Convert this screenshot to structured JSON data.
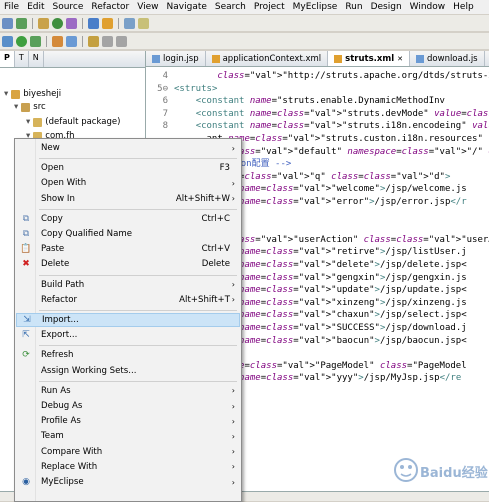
{
  "menubar": [
    "File",
    "Edit",
    "Source",
    "Refactor",
    "View",
    "Navigate",
    "Search",
    "Project",
    "MyEclipse",
    "Run",
    "Design",
    "Window",
    "Help"
  ],
  "left_tabs": [
    "P",
    "T",
    "N"
  ],
  "tree": [
    {
      "label": "biyesheji"
    },
    {
      "label": "src"
    },
    {
      "label": "(default package)"
    },
    {
      "label": "com.fh"
    }
  ],
  "editor_tabs": [
    {
      "label": "login.jsp",
      "active": false
    },
    {
      "label": "applicationContext.xml",
      "active": false
    },
    {
      "label": "struts.xml",
      "active": true
    },
    {
      "label": "download.js",
      "active": false
    }
  ],
  "code_lines": [
    {
      "ln": "4",
      "text": "        \"http://struts.apache.org/dtds/struts-2.0.dtd\""
    },
    {
      "ln": "5⊖",
      "text": "<struts>"
    },
    {
      "ln": "6",
      "text": "    <constant name=\"struts.enable.DynamicMethodInv"
    },
    {
      "ln": "7",
      "text": "    <constant name=\"struts.devMode\" value=\"true\" /"
    },
    {
      "ln": "8",
      "text": "    <constant name=\"struts.i18n.encodeing\" value=\""
    },
    {
      "ln": "",
      "text": "      ant name=\"struts.custon.i18n.resources\""
    },
    {
      "ln": "",
      "text": "  ge name=\"default\" namespace=\"/\" extends="
    },
    {
      "ln": "",
      "text": "  -- 订单Action配置 -->"
    },
    {
      "ln": "",
      "text": "  ction name=\"q\" class=\"d\">"
    },
    {
      "ln": "",
      "text": "    <result name=\"welcome\">/jsp/welcome.js"
    },
    {
      "ln": "",
      "text": "    <result name=\"error\">/jsp/error.jsp</r"
    },
    {
      "ln": "",
      "text": "  action>"
    },
    {
      "ln": "",
      "text": ""
    },
    {
      "ln": "",
      "text": "  on name=\"userAction\" class=\"userAction\">"
    },
    {
      "ln": "",
      "text": "    <result name=\"retirve\">/jsp/listUser.j"
    },
    {
      "ln": "",
      "text": "    <result name=\"delete\">/jsp/delete.jsp<"
    },
    {
      "ln": "",
      "text": "    <result name=\"gengxin\">/jsp/gengxin.js"
    },
    {
      "ln": "",
      "text": "    <result name=\"update\">/jsp/update.jsp<"
    },
    {
      "ln": "",
      "text": "    <result name=\"xinzeng\">/jsp/xinzeng.js"
    },
    {
      "ln": "",
      "text": "    <result name=\"chaxun\">/jsp/select.jsp<"
    },
    {
      "ln": "",
      "text": "    <result name=\"SUCCESS\">/jsp/download.j"
    },
    {
      "ln": "",
      "text": "    <result name=\"baocun\">/jsp/baocun.jsp<"
    },
    {
      "ln": "",
      "text": "  action>"
    },
    {
      "ln": "",
      "text": "  action name=\"PageModel\" class=\"PageModel"
    },
    {
      "ln": "",
      "text": "    <result name=\"yyy\">/jsp/MyJsp.jsp</re"
    },
    {
      "ln": "",
      "text": "  ction>"
    },
    {
      "ln": "",
      "text": "  age>"
    }
  ],
  "context_menu": [
    {
      "label": "New",
      "shortcut": "",
      "submenu": true,
      "icon": ""
    },
    {
      "sep": true
    },
    {
      "label": "Open",
      "shortcut": "F3",
      "submenu": false,
      "icon": ""
    },
    {
      "label": "Open With",
      "shortcut": "",
      "submenu": true,
      "icon": ""
    },
    {
      "label": "Show In",
      "shortcut": "Alt+Shift+W",
      "submenu": true,
      "icon": ""
    },
    {
      "sep": true
    },
    {
      "label": "Copy",
      "shortcut": "Ctrl+C",
      "submenu": false,
      "icon": "copy"
    },
    {
      "label": "Copy Qualified Name",
      "shortcut": "",
      "submenu": false,
      "icon": "copy"
    },
    {
      "label": "Paste",
      "shortcut": "Ctrl+V",
      "submenu": false,
      "icon": "paste"
    },
    {
      "label": "Delete",
      "shortcut": "Delete",
      "submenu": false,
      "icon": "delete"
    },
    {
      "sep": true
    },
    {
      "label": "Build Path",
      "shortcut": "",
      "submenu": true,
      "icon": ""
    },
    {
      "label": "Refactor",
      "shortcut": "Alt+Shift+T",
      "submenu": true,
      "icon": ""
    },
    {
      "sep": true
    },
    {
      "label": "Import...",
      "shortcut": "",
      "submenu": false,
      "icon": "import",
      "highlight": true
    },
    {
      "label": "Export...",
      "shortcut": "",
      "submenu": false,
      "icon": "export"
    },
    {
      "sep": true
    },
    {
      "label": "Refresh",
      "shortcut": "",
      "submenu": false,
      "icon": "refresh"
    },
    {
      "label": "Assign Working Sets...",
      "shortcut": "",
      "submenu": false,
      "icon": ""
    },
    {
      "sep": true
    },
    {
      "label": "Run As",
      "shortcut": "",
      "submenu": true,
      "icon": ""
    },
    {
      "label": "Debug As",
      "shortcut": "",
      "submenu": true,
      "icon": ""
    },
    {
      "label": "Profile As",
      "shortcut": "",
      "submenu": true,
      "icon": ""
    },
    {
      "label": "Team",
      "shortcut": "",
      "submenu": true,
      "icon": ""
    },
    {
      "label": "Compare With",
      "shortcut": "",
      "submenu": true,
      "icon": ""
    },
    {
      "label": "Replace With",
      "shortcut": "",
      "submenu": true,
      "icon": ""
    },
    {
      "label": "MyEclipse",
      "shortcut": "",
      "submenu": true,
      "icon": "myeclipse"
    }
  ],
  "watermark": "Baidu经验"
}
